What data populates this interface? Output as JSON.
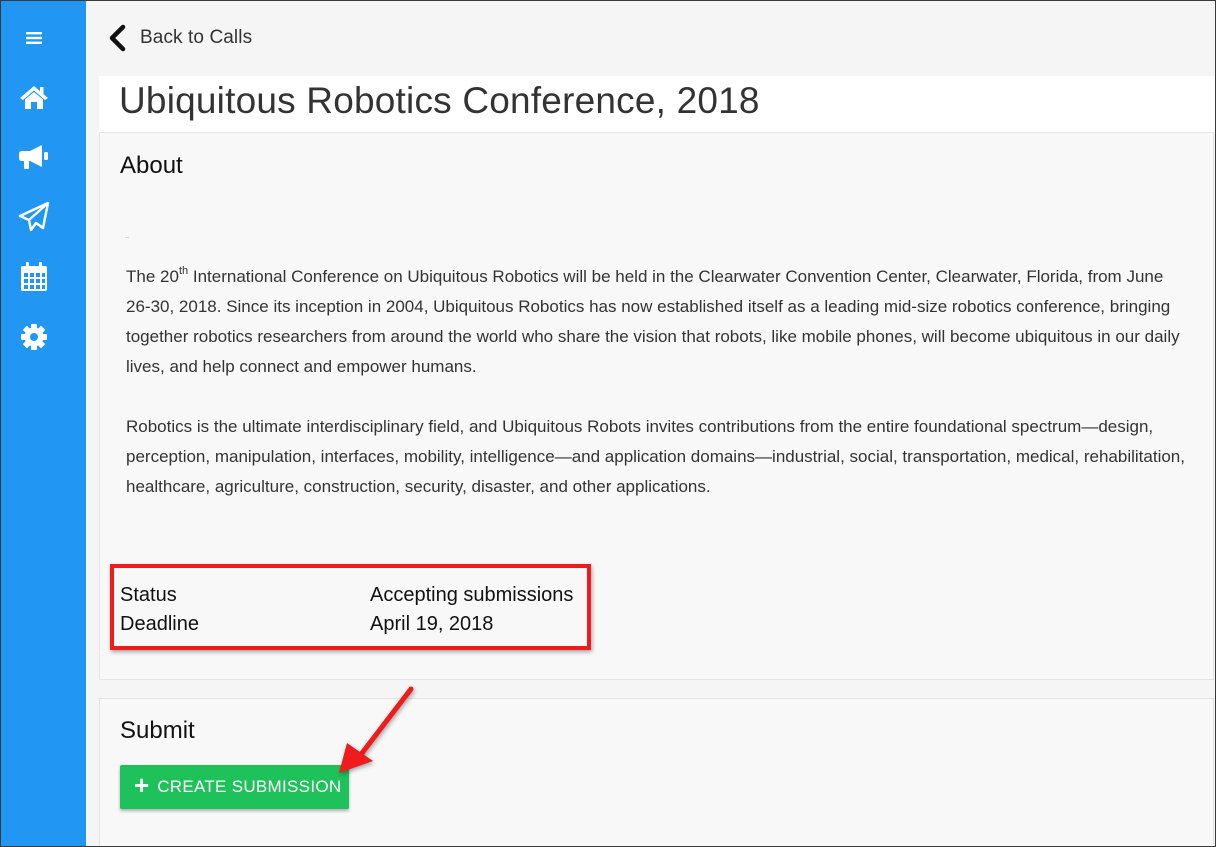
{
  "sidebar": {
    "items": [
      {
        "icon": "menu-icon"
      },
      {
        "icon": "home-icon"
      },
      {
        "icon": "megaphone-icon"
      },
      {
        "icon": "paper-plane-icon"
      },
      {
        "icon": "calendar-icon"
      },
      {
        "icon": "gear-icon"
      }
    ],
    "background_color": "#2196f3"
  },
  "header": {
    "back_label": "Back to Calls",
    "title": "Ubiquitous Robotics Conference, 2018"
  },
  "about": {
    "heading": "About",
    "p1_before": "The 20",
    "p1_sup": "th",
    "p1_after": " International Conference on Ubiquitous Robotics will be held in the Clearwater Convention Center, Clearwater, Florida, from June 26-30, 2018. Since its inception in 2004, Ubiquitous Robotics has now established itself as a leading mid-size robotics conference, bringing together robotics researchers from around the world who share the vision that robots, like mobile phones, will become ubiquitous in our daily lives, and help connect and empower humans.",
    "p2": "Robotics is the ultimate interdisciplinary field, and Ubiquitous Robots invites contributions from the entire foundational spectrum—design, perception, manipulation, interfaces, mobility, intelligence—and application domains—industrial, social, transportation, medical, rehabilitation, healthcare, agriculture, construction, security, disaster, and other applications.",
    "status_label": "Status",
    "status_value": "Accepting submissions",
    "deadline_label": "Deadline",
    "deadline_value": "April 19, 2018"
  },
  "submit": {
    "heading": "Submit",
    "button_label": "CREATE SUBMISSION",
    "button_color": "#1fc15a"
  },
  "annotation": {
    "highlight_color": "#ee1c1c"
  }
}
